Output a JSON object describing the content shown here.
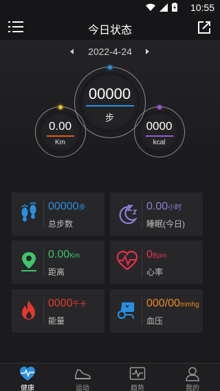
{
  "status_bar": {
    "time": "10:55"
  },
  "header": {
    "title": "今日状态"
  },
  "date": {
    "value": "2022-4-24"
  },
  "rings": {
    "steps": {
      "value": "00000",
      "unit": "步",
      "accent": "#2b8fe0"
    },
    "distance": {
      "value": "0.00",
      "unit": "Km",
      "accent": "#f08a1d"
    },
    "calories": {
      "value": "0000",
      "unit": "kcal",
      "accent": "#9b59d6"
    }
  },
  "cards": [
    {
      "value": "00000",
      "unit": "步",
      "label": "总步数",
      "color": "#2b8fe0",
      "icon": "footprints-icon"
    },
    {
      "value": "0.00",
      "unit": "小时",
      "label": "睡眠(今日)",
      "color": "#8e7fd6",
      "icon": "moon-sleep-icon"
    },
    {
      "value": "0.00",
      "unit": "Km",
      "label": "距离",
      "color": "#3fc56b",
      "icon": "map-pin-icon"
    },
    {
      "value": "0",
      "unit": "Bpm",
      "label": "心率",
      "color": "#e6304a",
      "icon": "heart-rate-icon"
    },
    {
      "value": "0000",
      "unit": "千卡",
      "label": "能量",
      "color": "#e23a2e",
      "icon": "flame-icon"
    },
    {
      "value": "000/00",
      "unit": "mmhg",
      "label": "血压",
      "color": "#f08a1d",
      "icon": "blood-pressure-icon"
    }
  ],
  "tabs": [
    {
      "label": "健康",
      "icon": "heart-pulse-icon",
      "active": true
    },
    {
      "label": "运动",
      "icon": "shoe-icon",
      "active": false
    },
    {
      "label": "趋势",
      "icon": "trend-chart-icon",
      "active": false
    },
    {
      "label": "我的",
      "icon": "profile-icon",
      "active": false
    }
  ]
}
